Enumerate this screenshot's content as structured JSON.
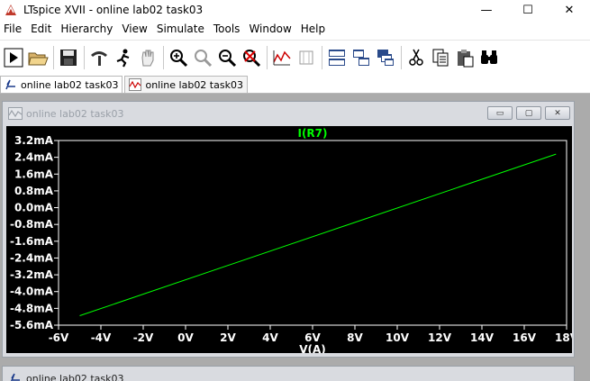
{
  "window": {
    "title": "LTspice XVII - online lab02 task03",
    "minimize": "—",
    "maximize": "☐",
    "close": "✕"
  },
  "menu": [
    "File",
    "Edit",
    "Hierarchy",
    "View",
    "Simulate",
    "Tools",
    "Window",
    "Help"
  ],
  "toolbar_icons": [
    "run-icon",
    "open-icon",
    "save-icon",
    "control-panel-icon",
    "halt-icon",
    "pan-hand-icon",
    "zoom-in-icon",
    "zoom-full-icon",
    "zoom-out-icon",
    "autorange-icon",
    "plot-settings-icon",
    "trace-window-icon",
    "tile-horizontal-icon",
    "tile-vertical-icon",
    "cascade-icon",
    "cut-icon",
    "copy-icon",
    "paste-icon",
    "find-icon"
  ],
  "tabs": [
    {
      "label": "online lab02 task03",
      "icon": "schematic-icon"
    },
    {
      "label": "online lab02 task03",
      "icon": "waveform-icon"
    }
  ],
  "plot_window": {
    "title": "online lab02 task03",
    "btn_min": "▭",
    "btn_max": "▢",
    "btn_close": "✕"
  },
  "second_window": {
    "title": "online lab02 task03"
  },
  "chart_data": {
    "type": "line",
    "title": "I(R7)",
    "xlabel": "V(A)",
    "ylabel": "",
    "x_ticks": [
      "-6V",
      "-4V",
      "-2V",
      "0V",
      "2V",
      "4V",
      "6V",
      "8V",
      "10V",
      "12V",
      "14V",
      "16V",
      "18V"
    ],
    "x_tick_values": [
      -6,
      -4,
      -2,
      0,
      2,
      4,
      6,
      8,
      10,
      12,
      14,
      16,
      18
    ],
    "y_ticks": [
      "3.2mA",
      "2.4mA",
      "1.6mA",
      "0.8mA",
      "0.0mA",
      "-0.8mA",
      "-1.6mA",
      "-2.4mA",
      "-3.2mA",
      "-4.0mA",
      "-4.8mA",
      "-5.6mA"
    ],
    "y_tick_values": [
      3.2,
      2.4,
      1.6,
      0.8,
      0.0,
      -0.8,
      -1.6,
      -2.4,
      -3.2,
      -4.0,
      -4.8,
      -5.6
    ],
    "xlim": [
      -6,
      18
    ],
    "ylim": [
      -5.6,
      3.2
    ],
    "series": [
      {
        "name": "I(R7)",
        "color": "#00ff00",
        "x": [
          -5,
          17.5
        ],
        "y": [
          -5.15,
          2.55
        ]
      }
    ],
    "grid": false,
    "background": "#000000",
    "axis_color": "#ffffff"
  }
}
